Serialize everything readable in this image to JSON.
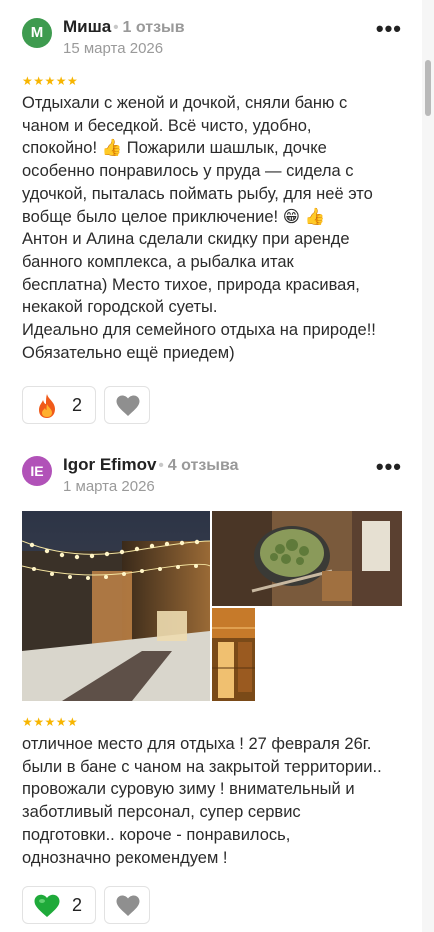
{
  "reviews": [
    {
      "avatar_letter": "М",
      "avatar_color": "#3e9b4f",
      "name": "Миша",
      "reviews_count": "1 отзыв",
      "date": "15 марта 2026",
      "rating": 5,
      "stars": "★★★★★",
      "text": "Отдыхали с женой и дочкой, сняли баню с\nчаном и беседкой. Всё чисто, удобно,\nспокойно! 👍  Пожарили шашлык, дочке\nособенно понравилось у пруда — сидела с\nудочкой, пыталась поймать рыбу, для неё это\nвобще было целое приключение! 😁 👍\nАнтон и Алина сделали скидку при аренде\nбанного комплекса, а рыбалка итак\nбесплатна) Место тихое, природа красивая,\nнекакой городской суеты.\nИдеально для семейного отдыха на природе!!\nОбязательно ещё приедем)",
      "reaction_icon": "fire-icon",
      "reaction_count": "2"
    },
    {
      "avatar_letter": "IE",
      "avatar_color": "#b152b8",
      "name": "Igor Efimov",
      "reviews_count": "4 отзыва",
      "date": "1 марта 2026",
      "rating": 5,
      "stars": "★★★★★",
      "text": "отличное место для отдыха ! 27 февраля 26г.\nбыли в бане с чаном на закрытой территории..\nпровожали суровую зиму ! внимательный и\nзаботливый персонал, супер сервис\nподготовки.. короче - понравилось,\nоднозначно рекомендуем !",
      "reaction_icon": "green-heart-icon",
      "reaction_count": "2",
      "photos": [
        "night-yard-photo",
        "vat-with-herbs-photo",
        "wooden-bathhouse-photo"
      ]
    }
  ],
  "colors": {
    "star": "#f7b500",
    "muted": "#9a9a9a"
  }
}
